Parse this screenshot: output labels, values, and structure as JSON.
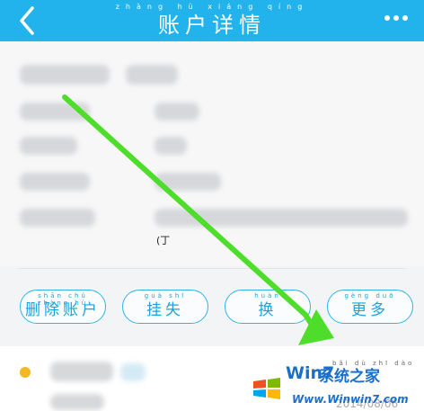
{
  "header": {
    "title": "账户详情",
    "title_pinyin": "zhàng hù xiáng qíng",
    "bg_color": "#22b3ec"
  },
  "info": {
    "visible_fragment": "(丁"
  },
  "actions": [
    {
      "label": "删除账户",
      "pinyin": "shān chú zhàng hù"
    },
    {
      "label": "挂失",
      "pinyin": "guà shī"
    },
    {
      "label": "换",
      "pinyin": "huàn"
    },
    {
      "label": "更多",
      "pinyin": "gèng duō"
    }
  ],
  "record": {
    "date": "2014/08/06",
    "pinyin": "bǎi dù zhī dào"
  },
  "icons": [
    "back-icon",
    "more-icon"
  ],
  "watermark": {
    "text_a": "Win7",
    "text_b": "系统之家",
    "url": "Www.Winwin7.com"
  },
  "accent_color": "#2eb4ea",
  "arrow_color": "#4ddd2a"
}
